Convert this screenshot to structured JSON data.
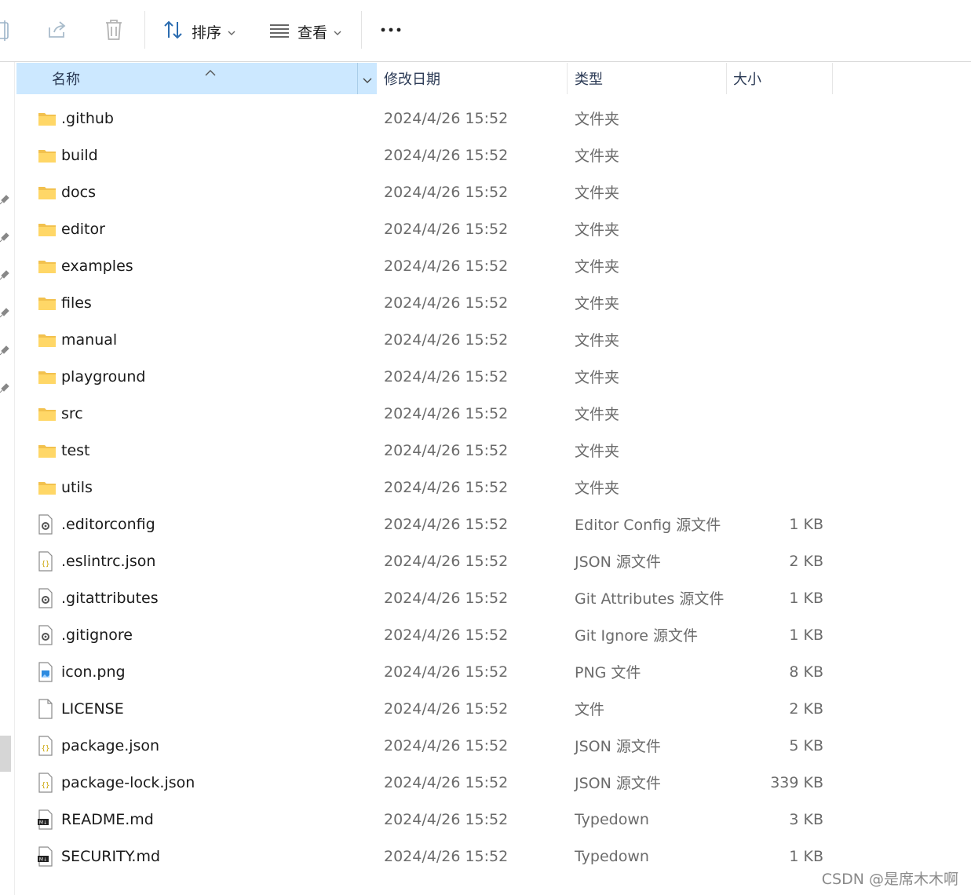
{
  "toolbar": {
    "sort_label": "排序",
    "view_label": "查看"
  },
  "columns": {
    "name": "名称",
    "date": "修改日期",
    "type": "类型",
    "size": "大小"
  },
  "files": [
    {
      "name": ".github",
      "date": "2024/4/26 15:52",
      "type": "文件夹",
      "size": "",
      "icon": "folder-icon"
    },
    {
      "name": "build",
      "date": "2024/4/26 15:52",
      "type": "文件夹",
      "size": "",
      "icon": "folder-icon"
    },
    {
      "name": "docs",
      "date": "2024/4/26 15:52",
      "type": "文件夹",
      "size": "",
      "icon": "folder-icon"
    },
    {
      "name": "editor",
      "date": "2024/4/26 15:52",
      "type": "文件夹",
      "size": "",
      "icon": "folder-icon"
    },
    {
      "name": "examples",
      "date": "2024/4/26 15:52",
      "type": "文件夹",
      "size": "",
      "icon": "folder-icon"
    },
    {
      "name": "files",
      "date": "2024/4/26 15:52",
      "type": "文件夹",
      "size": "",
      "icon": "folder-icon"
    },
    {
      "name": "manual",
      "date": "2024/4/26 15:52",
      "type": "文件夹",
      "size": "",
      "icon": "folder-icon"
    },
    {
      "name": "playground",
      "date": "2024/4/26 15:52",
      "type": "文件夹",
      "size": "",
      "icon": "folder-icon"
    },
    {
      "name": "src",
      "date": "2024/4/26 15:52",
      "type": "文件夹",
      "size": "",
      "icon": "folder-icon"
    },
    {
      "name": "test",
      "date": "2024/4/26 15:52",
      "type": "文件夹",
      "size": "",
      "icon": "folder-icon"
    },
    {
      "name": "utils",
      "date": "2024/4/26 15:52",
      "type": "文件夹",
      "size": "",
      "icon": "folder-icon"
    },
    {
      "name": ".editorconfig",
      "date": "2024/4/26 15:52",
      "type": "Editor Config 源文件",
      "size": "1 KB",
      "icon": "config-file-icon"
    },
    {
      "name": ".eslintrc.json",
      "date": "2024/4/26 15:52",
      "type": "JSON 源文件",
      "size": "2 KB",
      "icon": "json-file-icon"
    },
    {
      "name": ".gitattributes",
      "date": "2024/4/26 15:52",
      "type": "Git Attributes 源文件",
      "size": "1 KB",
      "icon": "config-file-icon"
    },
    {
      "name": ".gitignore",
      "date": "2024/4/26 15:52",
      "type": "Git Ignore 源文件",
      "size": "1 KB",
      "icon": "config-file-icon"
    },
    {
      "name": "icon.png",
      "date": "2024/4/26 15:52",
      "type": "PNG 文件",
      "size": "8 KB",
      "icon": "image-file-icon"
    },
    {
      "name": "LICENSE",
      "date": "2024/4/26 15:52",
      "type": "文件",
      "size": "2 KB",
      "icon": "blank-file-icon"
    },
    {
      "name": "package.json",
      "date": "2024/4/26 15:52",
      "type": "JSON 源文件",
      "size": "5 KB",
      "icon": "json-file-icon"
    },
    {
      "name": "package-lock.json",
      "date": "2024/4/26 15:52",
      "type": "JSON 源文件",
      "size": "339 KB",
      "icon": "json-file-icon"
    },
    {
      "name": "README.md",
      "date": "2024/4/26 15:52",
      "type": "Typedown",
      "size": "3 KB",
      "icon": "markdown-file-icon"
    },
    {
      "name": "SECURITY.md",
      "date": "2024/4/26 15:52",
      "type": "Typedown",
      "size": "1 KB",
      "icon": "markdown-file-icon"
    }
  ],
  "watermark": "CSDN @是席木木啊"
}
